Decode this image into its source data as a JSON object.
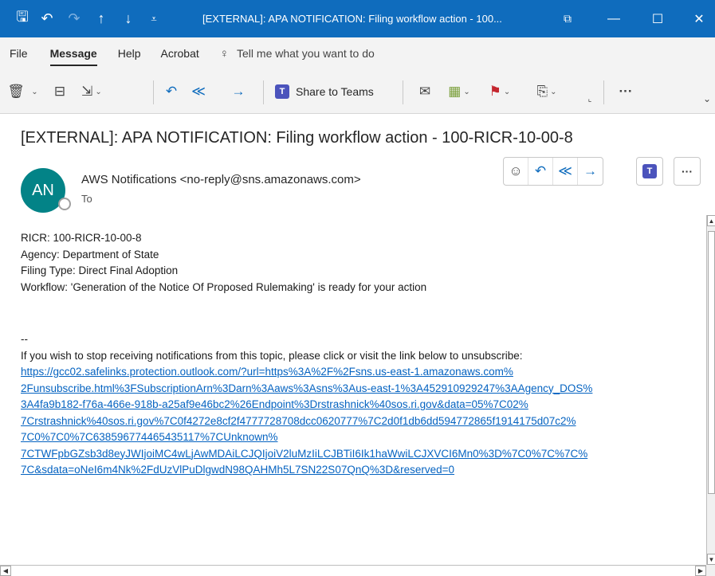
{
  "titlebar": {
    "title": "[EXTERNAL]: APA NOTIFICATION: Filing workflow action - 100...",
    "icons": [
      "save-icon",
      "undo-icon",
      "redo-icon",
      "arrow-up-icon",
      "arrow-down-icon",
      "customize-icon"
    ],
    "glyphs": {
      "save": "🖫",
      "undo": "↶",
      "redo": "↷",
      "up": "↑",
      "down": "↓",
      "customize": "⩡",
      "restore": "⧉",
      "minimize": "—",
      "maximize": "☐",
      "close": "✕"
    }
  },
  "menu": {
    "items": [
      "File",
      "Message",
      "Help",
      "Acrobat"
    ],
    "active": "Message",
    "tellme": "Tell me what you want to do"
  },
  "ribbon": {
    "share_to_teams": "Share to Teams",
    "glyphs": {
      "delete": "🗑",
      "archive": "⊟",
      "move": "⇲",
      "reply": "↶",
      "reply_all": "≪",
      "forward": "→",
      "teams": "T",
      "mark": "✉",
      "categorize": "▦",
      "flag": "⚑",
      "rules": "⎘",
      "more": "···",
      "collapse": "⌄",
      "launcher": "⌞"
    }
  },
  "header": {
    "subject": "[EXTERNAL]: APA NOTIFICATION: Filing workflow action - 100-RICR-10-00-8",
    "avatar_initials": "AN",
    "sender": "AWS Notifications <no-reply@sns.amazonaws.com>",
    "to_label": "To",
    "actions": {
      "emoji": "☺",
      "reply": "↶",
      "reply_all": "≪",
      "forward": "→",
      "teams": "T",
      "more": "···"
    }
  },
  "body": {
    "lines": [
      "RICR:   100-RICR-10-00-8",
      "Agency:  Department of State",
      "Filing Type: Direct Final Adoption",
      "Workflow: 'Generation of the Notice Of Proposed Rulemaking' is ready for your action"
    ],
    "signature": "--",
    "unsubscribe_text": "If you wish to stop receiving notifications from this topic, please click or visit the link below to unsubscribe:",
    "link_lines": [
      "https://gcc02.safelinks.protection.outlook.com/?url=https%3A%2F%2Fsns.us-east-1.amazonaws.com%",
      "2Funsubscribe.html%3FSubscriptionArn%3Darn%3Aaws%3Asns%3Aus-east-1%3A452910929247%3AAgency_DOS%",
      "3A4fa9b182-f76a-466e-918b-a25af9e46bc2%26Endpoint%3Drstrashnick%40sos.ri.gov&data=05%7C02%",
      "7Crstrashnick%40sos.ri.gov%7C0f4272e8cf2f4777728708dcc0620777%7C2d0f1db6dd594772865f1914175d07c2%",
      "7C0%7C0%7C638596774465435117%7CUnknown%",
      "7CTWFpbGZsb3d8eyJWIjoiMC4wLjAwMDAiLCJQIjoiV2luMzIiLCJBTiI6Ik1haWwiLCJXVCI6Mn0%3D%7C0%7C%7C%",
      "7C&sdata=oNeI6m4Nk%2FdUzVlPuDlgwdN98QAHMh5L7SN22S07QnQ%3D&reserved=0"
    ]
  },
  "scroll": {
    "up": "▲",
    "down": "▼",
    "left": "◀",
    "right": "▶"
  }
}
